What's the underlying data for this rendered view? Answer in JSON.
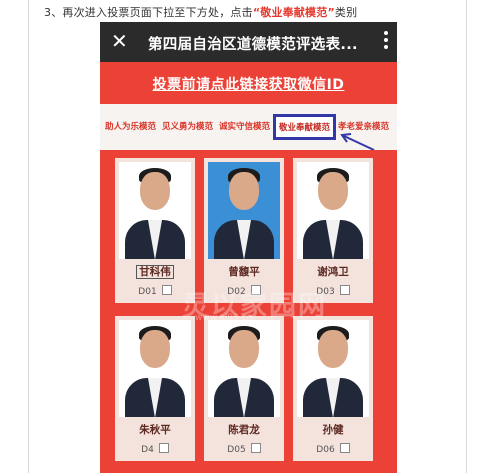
{
  "instruction": {
    "prefix": "3、再次进入投票页面下拉至下方处，点击",
    "highlight": "“敬业奉献模范”",
    "suffix": "类别"
  },
  "app": {
    "title": "第四届自治区道德模范评选表...",
    "close_icon": "close-icon",
    "more_icon": "more-vertical-icon"
  },
  "id_link": "投票前请点此链接获取微信ID",
  "tabs": [
    "助人为乐模范",
    "见义勇为模范",
    "诚实守信模范",
    "敬业奉献模范",
    "孝老爱亲模范"
  ],
  "active_tab_index": 3,
  "candidates": [
    {
      "name": "甘科伟",
      "code": "D01"
    },
    {
      "name": "曾馥平",
      "code": "D02"
    },
    {
      "name": "谢鸿卫",
      "code": "D03"
    },
    {
      "name": "朱秋平",
      "code": "D4"
    },
    {
      "name": "陈君龙",
      "code": "D05"
    },
    {
      "name": "孙健",
      "code": "D06"
    }
  ],
  "watermark": {
    "text": "灵以家园网",
    "url": "www.ql93.cn"
  },
  "colors": {
    "page_red": "#eb4136",
    "titlebar": "#2b2b2b",
    "active_tab_border": "#3338a6",
    "highlight_red": "#e53a2f"
  }
}
